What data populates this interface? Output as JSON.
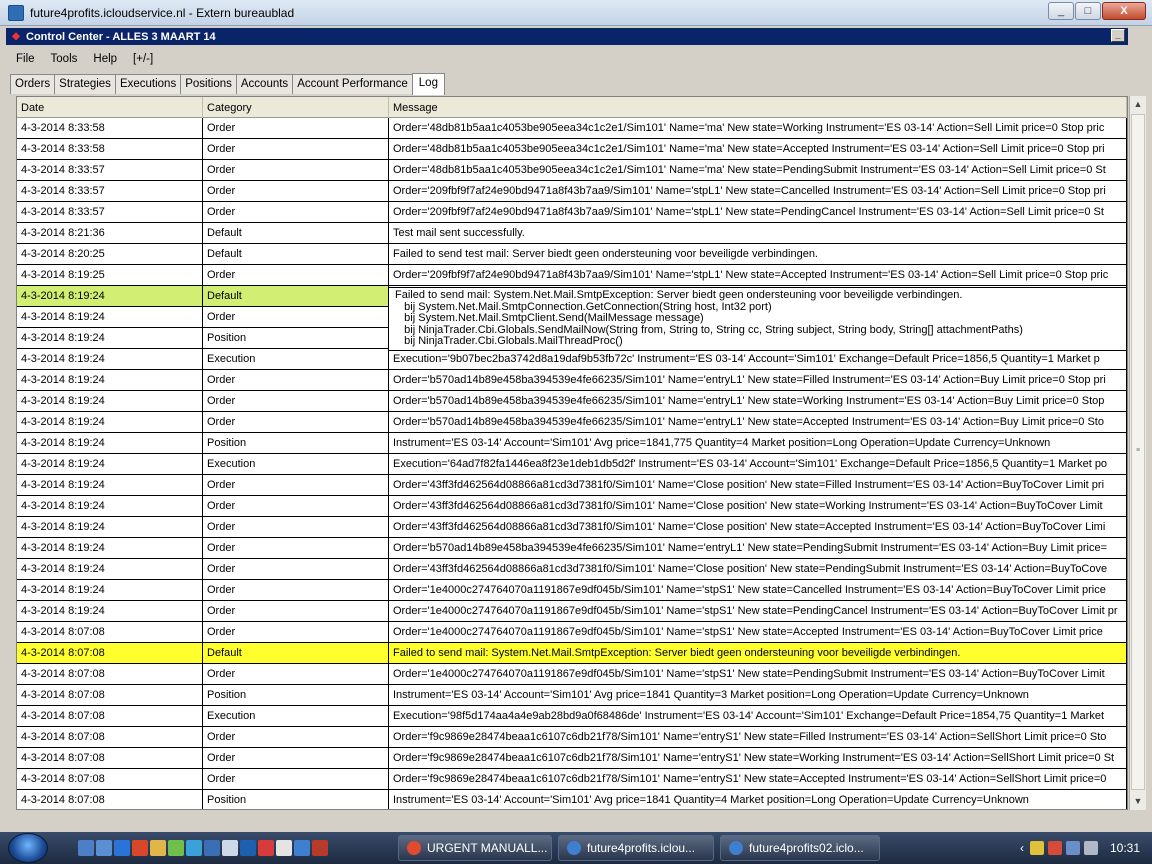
{
  "rdp_window": {
    "title": "future4profits.icloudservice.nl - Extern bureaublad",
    "min": "_",
    "max": "□",
    "close": "X"
  },
  "app": {
    "title": "Control Center - ALLES 3 MAART 14",
    "min": "_"
  },
  "menu": [
    "File",
    "Tools",
    "Help",
    "[+/-]"
  ],
  "tabs": [
    "Orders",
    "Strategies",
    "Executions",
    "Positions",
    "Accounts",
    "Account Performance",
    "Log"
  ],
  "grid": {
    "columns": [
      "Date",
      "Category",
      "Message"
    ],
    "rows": [
      {
        "date": "4-3-2014 8:33:58",
        "category": "Order",
        "message": "Order='48db81b5aa1c4053be905eea34c1c2e1/Sim101' Name='ma' New state=Working Instrument='ES 03-14' Action=Sell Limit price=0 Stop pric"
      },
      {
        "date": "4-3-2014 8:33:58",
        "category": "Order",
        "message": "Order='48db81b5aa1c4053be905eea34c1c2e1/Sim101' Name='ma' New state=Accepted Instrument='ES 03-14' Action=Sell Limit price=0 Stop pri"
      },
      {
        "date": "4-3-2014 8:33:57",
        "category": "Order",
        "message": "Order='48db81b5aa1c4053be905eea34c1c2e1/Sim101' Name='ma' New state=PendingSubmit Instrument='ES 03-14' Action=Sell Limit price=0 St"
      },
      {
        "date": "4-3-2014 8:33:57",
        "category": "Order",
        "message": "Order='209fbf9f7af24e90bd9471a8f43b7aa9/Sim101' Name='stpL1' New state=Cancelled Instrument='ES 03-14' Action=Sell Limit price=0 Stop pri"
      },
      {
        "date": "4-3-2014 8:33:57",
        "category": "Order",
        "message": "Order='209fbf9f7af24e90bd9471a8f43b7aa9/Sim101' Name='stpL1' New state=PendingCancel Instrument='ES 03-14' Action=Sell Limit price=0 St"
      },
      {
        "date": "4-3-2014 8:21:36",
        "category": "Default",
        "message": "Test mail sent successfully."
      },
      {
        "date": "4-3-2014 8:20:25",
        "category": "Default",
        "message": "Failed to send test mail: Server biedt geen ondersteuning voor beveiligde verbindingen."
      },
      {
        "date": "4-3-2014 8:19:25",
        "category": "Order",
        "message": "Order='209fbf9f7af24e90bd9471a8f43b7aa9/Sim101' Name='stpL1' New state=Accepted Instrument='ES 03-14' Action=Sell Limit price=0 Stop pric"
      },
      {
        "date": "4-3-2014 8:19:24",
        "category": "Default",
        "message": "",
        "highlight": "green"
      },
      {
        "date": "4-3-2014 8:19:24",
        "category": "Order",
        "message": ""
      },
      {
        "date": "4-3-2014 8:19:24",
        "category": "Position",
        "message": ""
      },
      {
        "date": "4-3-2014 8:19:24",
        "category": "Execution",
        "message": "Execution='9b07bec2ba3742d8a19daf9b53fb72c' Instrument='ES 03-14' Account='Sim101' Exchange=Default Price=1856,5 Quantity=1 Market p"
      },
      {
        "date": "4-3-2014 8:19:24",
        "category": "Order",
        "message": "Order='b570ad14b89e458ba394539e4fe66235/Sim101' Name='entryL1' New state=Filled Instrument='ES 03-14' Action=Buy Limit price=0 Stop pri"
      },
      {
        "date": "4-3-2014 8:19:24",
        "category": "Order",
        "message": "Order='b570ad14b89e458ba394539e4fe66235/Sim101' Name='entryL1' New state=Working Instrument='ES 03-14' Action=Buy Limit price=0 Stop"
      },
      {
        "date": "4-3-2014 8:19:24",
        "category": "Order",
        "message": "Order='b570ad14b89e458ba394539e4fe66235/Sim101' Name='entryL1' New state=Accepted Instrument='ES 03-14' Action=Buy Limit price=0 Sto"
      },
      {
        "date": "4-3-2014 8:19:24",
        "category": "Position",
        "message": "Instrument='ES 03-14' Account='Sim101' Avg price=1841,775 Quantity=4 Market position=Long Operation=Update Currency=Unknown"
      },
      {
        "date": "4-3-2014 8:19:24",
        "category": "Execution",
        "message": "Execution='64ad7f82fa1446ea8f23e1deb1db5d2f' Instrument='ES 03-14' Account='Sim101' Exchange=Default Price=1856,5 Quantity=1 Market po"
      },
      {
        "date": "4-3-2014 8:19:24",
        "category": "Order",
        "message": "Order='43ff3fd462564d08866a81cd3d7381f0/Sim101' Name='Close position' New state=Filled Instrument='ES 03-14' Action=BuyToCover Limit pri"
      },
      {
        "date": "4-3-2014 8:19:24",
        "category": "Order",
        "message": "Order='43ff3fd462564d08866a81cd3d7381f0/Sim101' Name='Close position' New state=Working Instrument='ES 03-14' Action=BuyToCover Limit"
      },
      {
        "date": "4-3-2014 8:19:24",
        "category": "Order",
        "message": "Order='43ff3fd462564d08866a81cd3d7381f0/Sim101' Name='Close position' New state=Accepted Instrument='ES 03-14' Action=BuyToCover Limi"
      },
      {
        "date": "4-3-2014 8:19:24",
        "category": "Order",
        "message": "Order='b570ad14b89e458ba394539e4fe66235/Sim101' Name='entryL1' New state=PendingSubmit Instrument='ES 03-14' Action=Buy Limit price="
      },
      {
        "date": "4-3-2014 8:19:24",
        "category": "Order",
        "message": "Order='43ff3fd462564d08866a81cd3d7381f0/Sim101' Name='Close position' New state=PendingSubmit Instrument='ES 03-14' Action=BuyToCove"
      },
      {
        "date": "4-3-2014 8:19:24",
        "category": "Order",
        "message": "Order='1e4000c274764070a1191867e9df045b/Sim101' Name='stpS1' New state=Cancelled Instrument='ES 03-14' Action=BuyToCover Limit price"
      },
      {
        "date": "4-3-2014 8:19:24",
        "category": "Order",
        "message": "Order='1e4000c274764070a1191867e9df045b/Sim101' Name='stpS1' New state=PendingCancel Instrument='ES 03-14' Action=BuyToCover Limit pr"
      },
      {
        "date": "4-3-2014 8:07:08",
        "category": "Order",
        "message": "Order='1e4000c274764070a1191867e9df045b/Sim101' Name='stpS1' New state=Accepted Instrument='ES 03-14' Action=BuyToCover Limit price"
      },
      {
        "date": "4-3-2014 8:07:08",
        "category": "Default",
        "message": "Failed to send mail: System.Net.Mail.SmtpException: Server biedt geen ondersteuning voor beveiligde verbindingen.",
        "highlight": "yellow"
      },
      {
        "date": "4-3-2014 8:07:08",
        "category": "Order",
        "message": "Order='1e4000c274764070a1191867e9df045b/Sim101' Name='stpS1' New state=PendingSubmit Instrument='ES 03-14' Action=BuyToCover Limit"
      },
      {
        "date": "4-3-2014 8:07:08",
        "category": "Position",
        "message": "Instrument='ES 03-14' Account='Sim101' Avg price=1841 Quantity=3 Market position=Long Operation=Update Currency=Unknown"
      },
      {
        "date": "4-3-2014 8:07:08",
        "category": "Execution",
        "message": "Execution='98f5d174aa4a4e9ab28bd9a0f68486de' Instrument='ES 03-14' Account='Sim101' Exchange=Default Price=1854,75 Quantity=1 Market"
      },
      {
        "date": "4-3-2014 8:07:08",
        "category": "Order",
        "message": "Order='f9c9869e28474beaa1c6107c6db21f78/Sim101' Name='entryS1' New state=Filled Instrument='ES 03-14' Action=SellShort Limit price=0 Sto"
      },
      {
        "date": "4-3-2014 8:07:08",
        "category": "Order",
        "message": "Order='f9c9869e28474beaa1c6107c6db21f78/Sim101' Name='entryS1' New state=Working Instrument='ES 03-14' Action=SellShort Limit price=0 St"
      },
      {
        "date": "4-3-2014 8:07:08",
        "category": "Order",
        "message": "Order='f9c9869e28474beaa1c6107c6db21f78/Sim101' Name='entryS1' New state=Accepted Instrument='ES 03-14' Action=SellShort Limit price=0"
      },
      {
        "date": "4-3-2014 8:07:08",
        "category": "Position",
        "message": "Instrument='ES 03-14' Account='Sim101' Avg price=1841 Quantity=4 Market position=Long Operation=Update Currency=Unknown"
      }
    ]
  },
  "tooltip": {
    "lines": [
      "Failed to send mail: System.Net.Mail.SmtpException: Server biedt geen ondersteuning voor beveiligde verbindingen.",
      "   bij System.Net.Mail.SmtpConnection.GetConnection(String host, Int32 port)",
      "   bij System.Net.Mail.SmtpClient.Send(MailMessage message)",
      "   bij NinjaTrader.Cbi.Globals.SendMailNow(String from, String to, String cc, String subject, String body, String[] attachmentPaths)",
      "   bij NinjaTrader.Cbi.Globals.MailThreadProc()"
    ]
  },
  "taskbar": {
    "tasks": [
      {
        "label": "URGENT MANUALL...",
        "icon": "chrome-icon",
        "color": "#e04a2f"
      },
      {
        "label": "future4profits.iclou...",
        "icon": "remote-desktop-icon",
        "color": "#3f7fd0"
      },
      {
        "label": "future4profits02.iclo...",
        "icon": "remote-desktop-icon",
        "color": "#3f7fd0"
      }
    ],
    "clock": "10:31"
  }
}
